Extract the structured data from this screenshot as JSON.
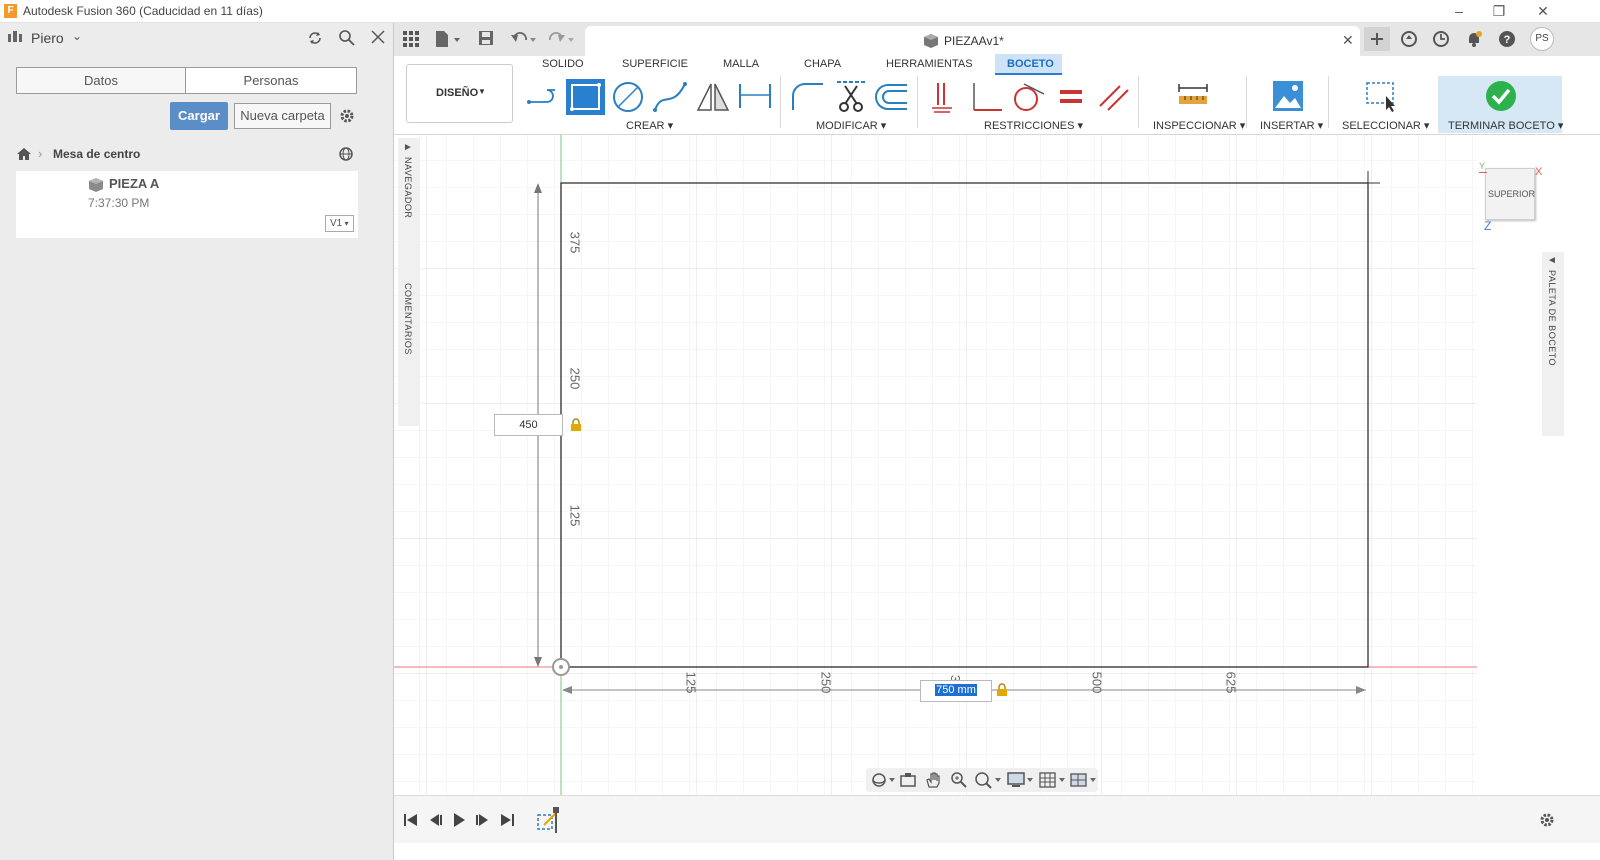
{
  "window": {
    "title": "Autodesk Fusion 360 (Caducidad en 11 días)",
    "app_icon_letter": "F"
  },
  "left_panel": {
    "user": "Piero",
    "tabs": [
      "Datos",
      "Personas"
    ],
    "upload_label": "Cargar",
    "new_folder_label": "Nueva carpeta",
    "breadcrumb": "Mesa de centro",
    "item": {
      "name": "PIEZA A",
      "time": "7:37:30 PM",
      "version": "V1"
    }
  },
  "document": {
    "tab_title": "PIEZAAv1*"
  },
  "toolbar": {
    "workspace": "DISEÑO",
    "tabs": [
      "SOLIDO",
      "SUPERFICIE",
      "MALLA",
      "CHAPA",
      "HERRAMIENTAS",
      "BOCETO"
    ],
    "active_tab": "BOCETO",
    "groups": {
      "crear": "CREAR",
      "modificar": "MODIFICAR",
      "restricciones": "RESTRICCIONES",
      "inspeccionar": "INSPECCIONAR",
      "insertar": "INSERTAR",
      "seleccionar": "SELECCIONAR",
      "terminar": "TERMINAR BOCETO"
    },
    "user_initials": "PS"
  },
  "canvas": {
    "navigator_label": "NAVEGADOR",
    "comments_label": "COMENTARIOS",
    "palette_label": "PALETA DE BOCETO",
    "viewcube_label": "SUPERIOR",
    "axis_x": "X",
    "axis_y": "Y",
    "axis_z": "Z",
    "vertical_ticks": [
      "375",
      "250",
      "125"
    ],
    "horizontal_ticks": [
      "125",
      "250",
      "3",
      "500",
      "625"
    ],
    "height_dimension": "450",
    "width_dimension": "750 mm"
  }
}
